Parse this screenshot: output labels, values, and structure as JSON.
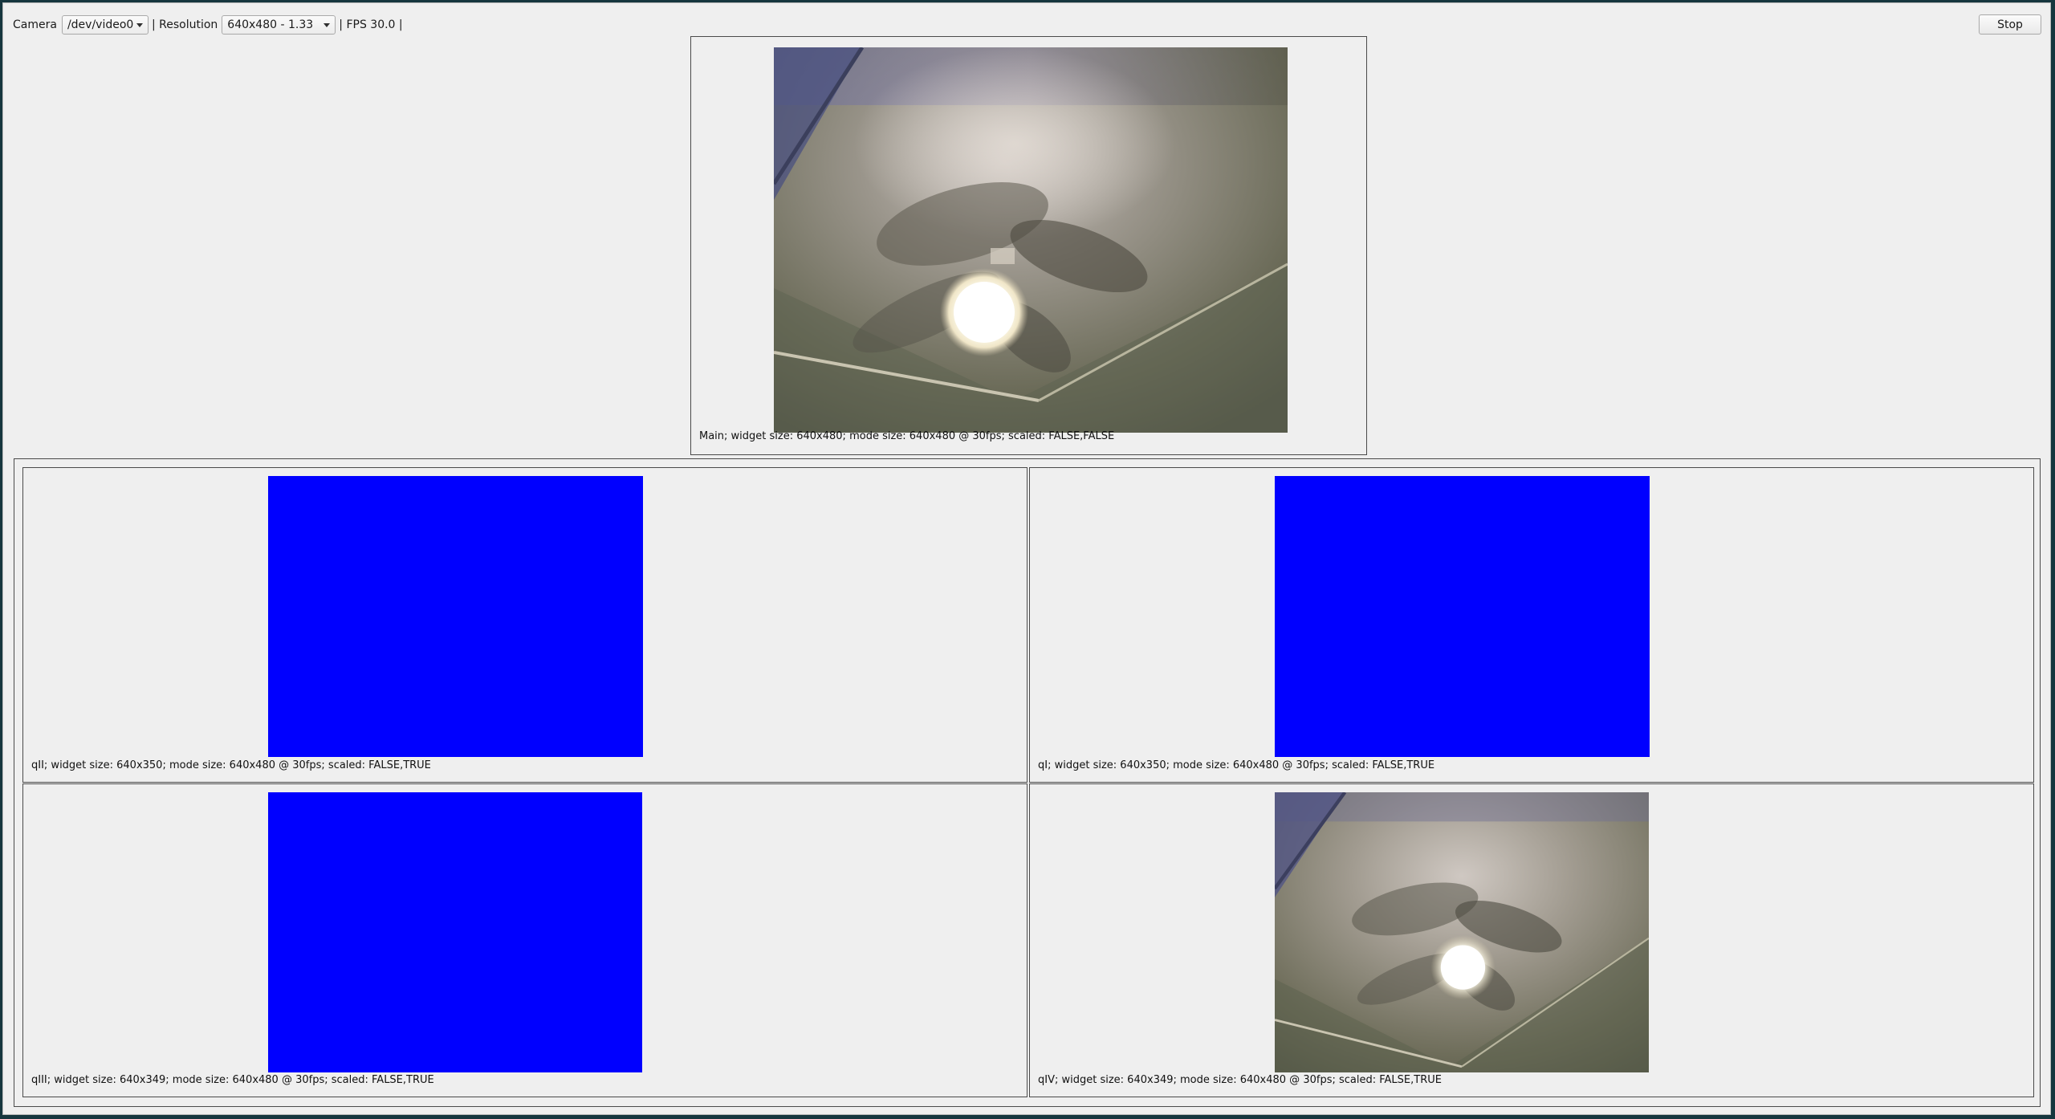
{
  "toolbar": {
    "camera_label": "Camera",
    "camera_value": "/dev/video0",
    "separator1": "| Resolution",
    "resolution_value": "640x480 - 1.33",
    "fps_text": "| FPS 30.0 |",
    "stop_label": "Stop"
  },
  "main_view": {
    "caption": "Main; widget size: 640x480; mode size: 640x480 @ 30fps; scaled: FALSE,FALSE"
  },
  "quadrants": {
    "qII": {
      "caption": "qII; widget size: 640x350; mode size: 640x480 @ 30fps; scaled: FALSE,TRUE",
      "fill": "#0000ff"
    },
    "qI": {
      "caption": "qI; widget size: 640x350; mode size: 640x480 @ 30fps; scaled: FALSE,TRUE",
      "fill": "#0000ff"
    },
    "qIII": {
      "caption": "qIII; widget size: 640x349; mode size: 640x480 @ 30fps; scaled: FALSE,TRUE",
      "fill": "#0000ff"
    },
    "qIV": {
      "caption": "qIV; widget size: 640x349; mode size: 640x480 @ 30fps; scaled: FALSE,TRUE"
    }
  }
}
